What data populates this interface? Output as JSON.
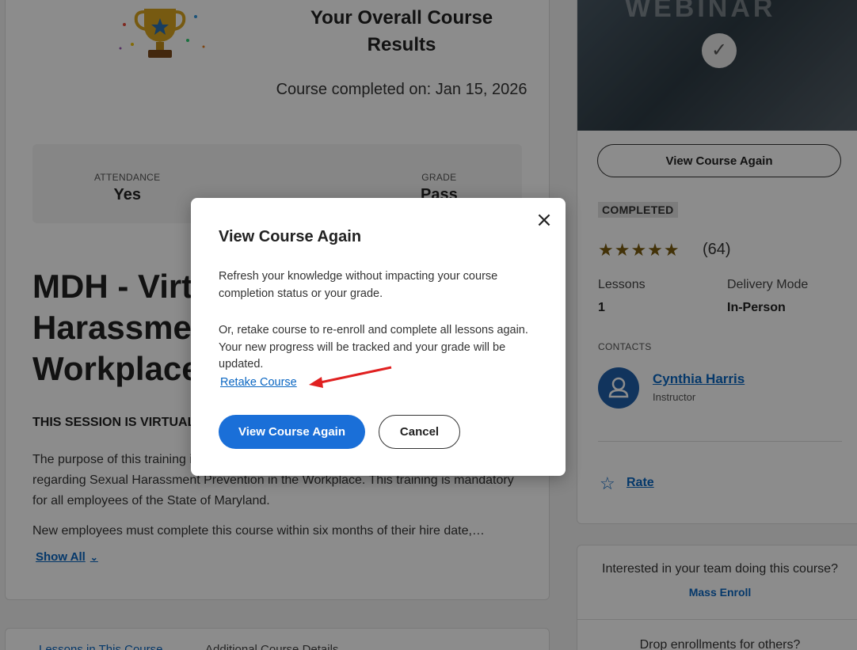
{
  "results": {
    "title": "Your Overall Course Results",
    "completed_on": "Course completed on: Jan 15, 2026",
    "attendance_label": "ATTENDANCE",
    "attendance_value": "Yes",
    "grade_label": "GRADE",
    "grade_value": "Pass"
  },
  "course": {
    "title": "MDH - Virtual Sexual Harassment Prevention in the Workplace",
    "session_note": "THIS SESSION IS VIRTUAL",
    "description": "The purpose of this training is to provide information to State of Maryland employees regarding Sexual Harassment Prevention in the Workplace. This training is mandatory for all employees of the State of Maryland.",
    "description2": "New employees must complete this course within six months of their hire date,…",
    "show_all": "Show All"
  },
  "tabs": {
    "lessons": "Lessons in This Course",
    "additional": "Additional Course Details"
  },
  "sidebar": {
    "hero_text": "WEBINAR",
    "view_again_button": "View Course Again",
    "status_badge": "COMPLETED",
    "stars": "★★★★★",
    "rating_count": "(64)",
    "lessons_label": "Lessons",
    "lessons_value": "1",
    "delivery_label": "Delivery Mode",
    "delivery_value": "In-Person",
    "contacts_label": "CONTACTS",
    "contact_name": "Cynthia Harris",
    "contact_role": "Instructor",
    "rate_label": "Rate",
    "interested": "Interested in your team doing this course?",
    "mass_enroll": "Mass Enroll",
    "drop_enroll": "Drop enrollments for others?"
  },
  "modal": {
    "title": "View Course Again",
    "paragraph1": "Refresh your knowledge without impacting your course completion status or your grade.",
    "paragraph2": "Or, retake course to re-enroll and complete all lessons again. Your new progress will be tracked and your grade will be updated.",
    "retake_link": "Retake Course",
    "primary_button": "View Course Again",
    "cancel_button": "Cancel",
    "close_icon": "×"
  },
  "colors": {
    "accent": "#1a6fd8",
    "link": "#0a66c2",
    "annotation_arrow": "#e02020"
  }
}
